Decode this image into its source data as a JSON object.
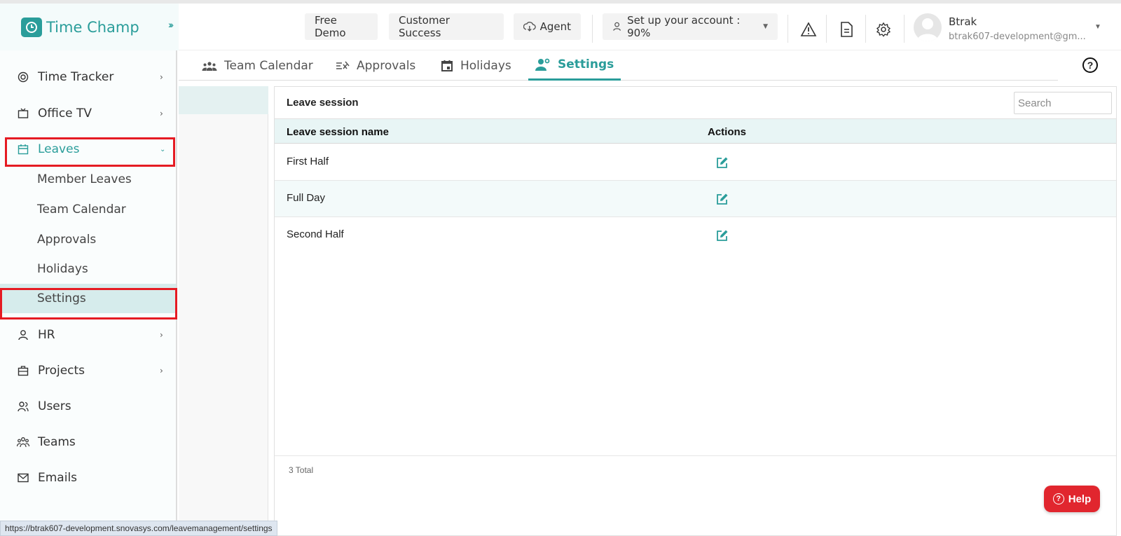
{
  "brand": {
    "name": "Time Champ",
    "color": "#2a9d9a"
  },
  "header": {
    "free_demo": "Free Demo",
    "customer_success": "Customer Success",
    "agent": "Agent",
    "setup": "Set up your account : 90%",
    "user_name": "Btrak",
    "user_email": "btrak607-development@gm..."
  },
  "sidebar": {
    "time_tracker": "Time Tracker",
    "office_tv": "Office TV",
    "leaves": "Leaves",
    "member_leaves": "Member Leaves",
    "team_calendar": "Team Calendar",
    "approvals": "Approvals",
    "holidays": "Holidays",
    "settings": "Settings",
    "hr": "HR",
    "projects": "Projects",
    "users": "Users",
    "teams": "Teams",
    "emails": "Emails"
  },
  "tabs": {
    "team_calendar": "Team Calendar",
    "approvals": "Approvals",
    "holidays": "Holidays",
    "settings": "Settings"
  },
  "card": {
    "title": "Leave session",
    "search_placeholder": "Search",
    "col_name": "Leave session name",
    "col_actions": "Actions",
    "rows": [
      {
        "name": "First Half"
      },
      {
        "name": "Full Day"
      },
      {
        "name": "Second Half"
      }
    ],
    "total": "3 Total"
  },
  "help_button": "Help",
  "status_url": "https://btrak607-development.snovasys.com/leavemanagement/settings",
  "colors": {
    "highlight": "#e51b23",
    "accent": "#2a9d9a",
    "help": "#e1262e"
  }
}
